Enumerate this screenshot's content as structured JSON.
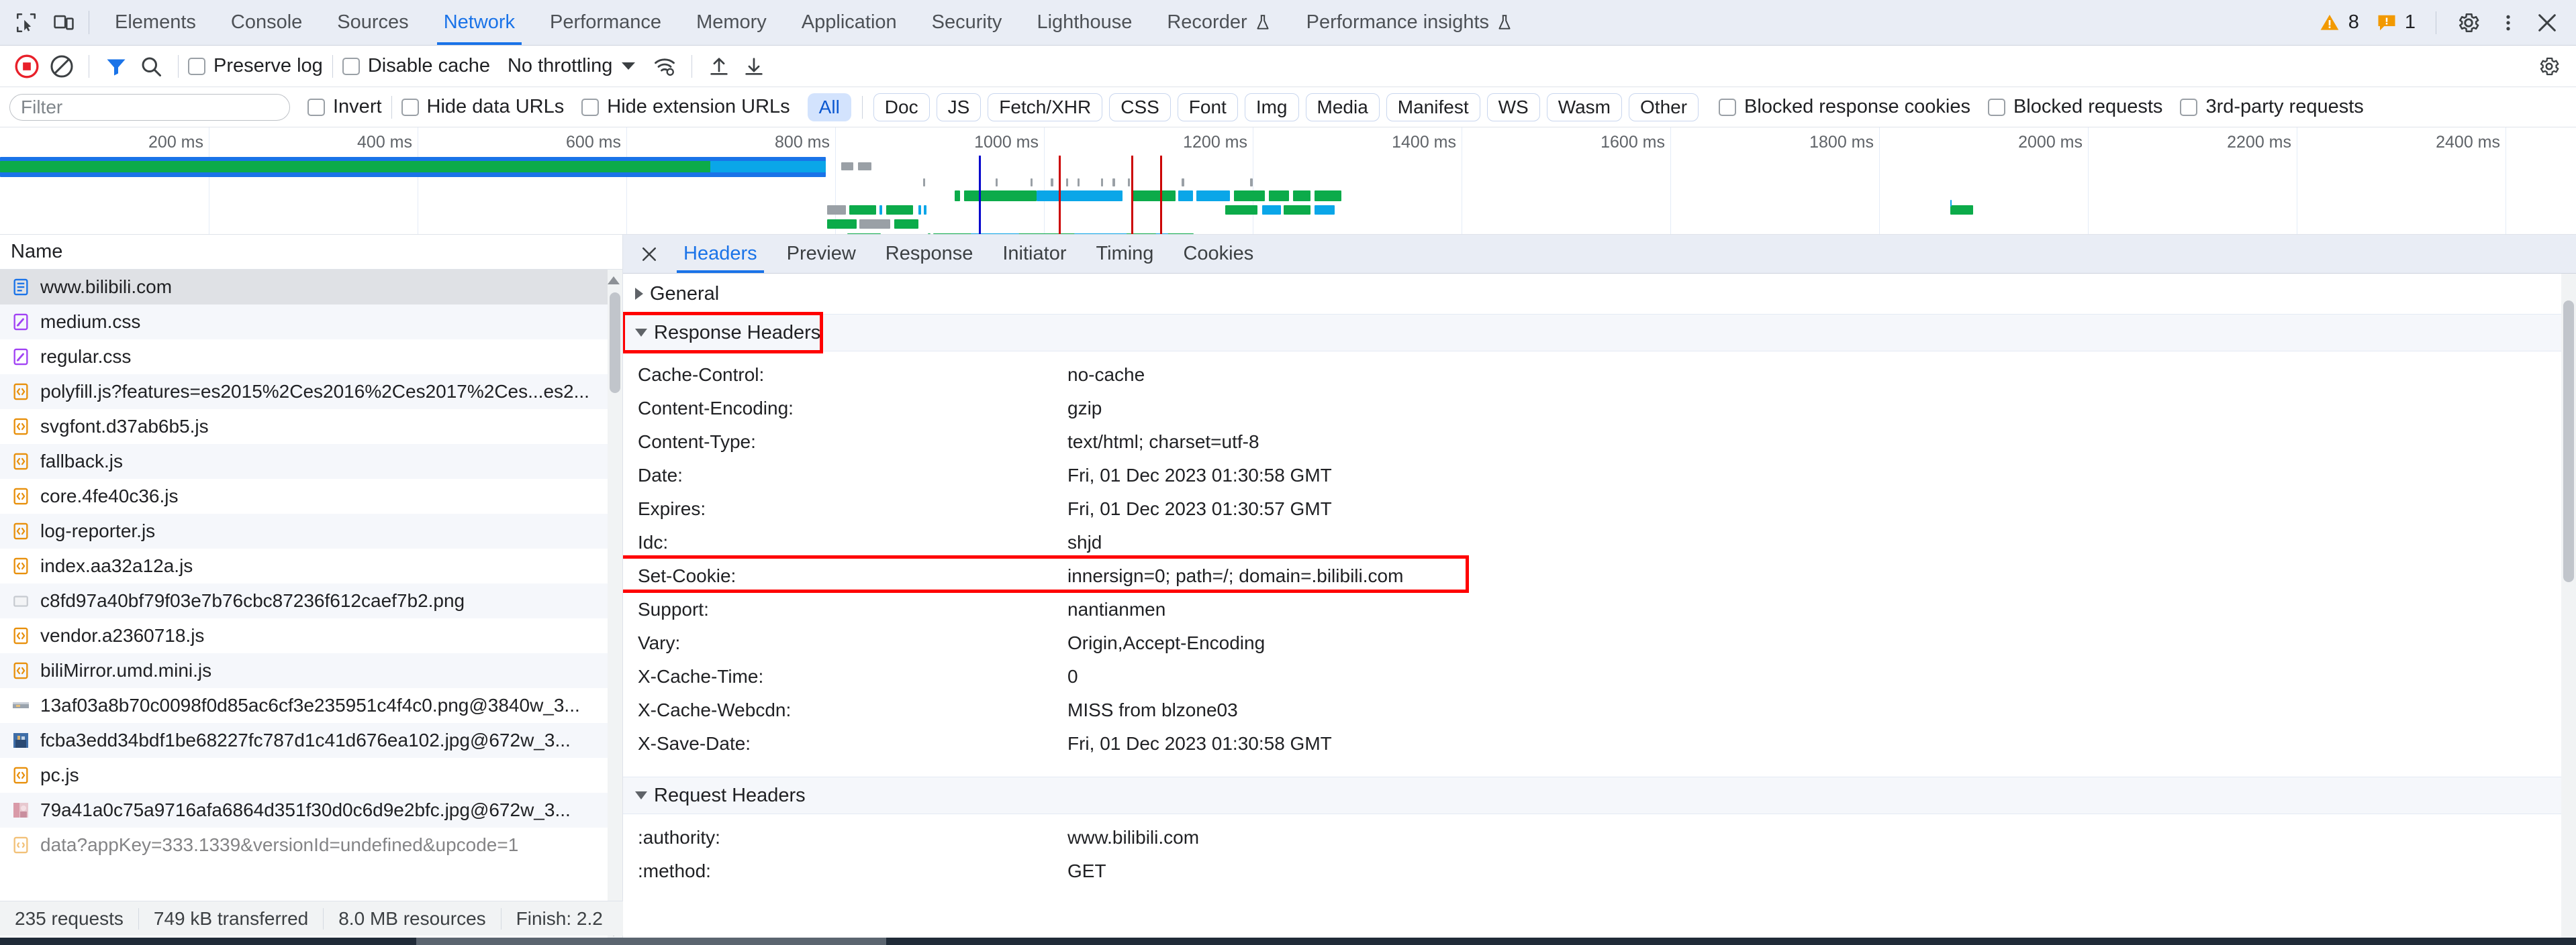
{
  "tabbar": {
    "icons": [
      {
        "name": "inspect-element-icon"
      },
      {
        "name": "device-toolbar-icon"
      }
    ],
    "tabs": [
      {
        "label": "Elements",
        "active": false,
        "flask": false
      },
      {
        "label": "Console",
        "active": false,
        "flask": false
      },
      {
        "label": "Sources",
        "active": false,
        "flask": false
      },
      {
        "label": "Network",
        "active": true,
        "flask": false
      },
      {
        "label": "Performance",
        "active": false,
        "flask": false
      },
      {
        "label": "Memory",
        "active": false,
        "flask": false
      },
      {
        "label": "Application",
        "active": false,
        "flask": false
      },
      {
        "label": "Security",
        "active": false,
        "flask": false
      },
      {
        "label": "Lighthouse",
        "active": false,
        "flask": false
      },
      {
        "label": "Recorder",
        "active": false,
        "flask": true
      },
      {
        "label": "Performance insights",
        "active": false,
        "flask": true
      }
    ],
    "warnings_count": "8",
    "issues_count": "1",
    "active_color": "#1a73e8",
    "warning_color": "#f29900"
  },
  "toolbar": {
    "record_title": "record-button",
    "clear_title": "clear-button",
    "preserve_log_label": "Preserve log",
    "preserve_log_checked": false,
    "disable_cache_label": "Disable cache",
    "disable_cache_checked": false,
    "throttling_value": "No throttling"
  },
  "filterbar": {
    "filter_placeholder": "Filter",
    "filter_value": "",
    "invert_label": "Invert",
    "hide_data_urls_label": "Hide data URLs",
    "hide_extension_urls_label": "Hide extension URLs",
    "types": [
      {
        "label": "All",
        "active": true
      },
      {
        "label": "Doc",
        "active": false
      },
      {
        "label": "JS",
        "active": false
      },
      {
        "label": "Fetch/XHR",
        "active": false
      },
      {
        "label": "CSS",
        "active": false
      },
      {
        "label": "Font",
        "active": false
      },
      {
        "label": "Img",
        "active": false
      },
      {
        "label": "Media",
        "active": false
      },
      {
        "label": "Manifest",
        "active": false
      },
      {
        "label": "WS",
        "active": false
      },
      {
        "label": "Wasm",
        "active": false
      },
      {
        "label": "Other",
        "active": false
      }
    ],
    "blocked_response_cookies_label": "Blocked response cookies",
    "blocked_requests_label": "Blocked requests",
    "third_party_requests_label": "3rd-party requests"
  },
  "overview": {
    "tick_labels": [
      "200 ms",
      "400 ms",
      "600 ms",
      "800 ms",
      "1000 ms",
      "1200 ms",
      "1400 ms",
      "1600 ms",
      "1800 ms",
      "2000 ms",
      "2200 ms",
      "2400 ms"
    ],
    "dcl_event_color": "#0000cc",
    "load_event_color": "#cc0000"
  },
  "requests": {
    "column_header": "Name",
    "items": [
      {
        "name": "www.bilibili.com",
        "type": "doc",
        "selected": true
      },
      {
        "name": "medium.css",
        "type": "css",
        "selected": false
      },
      {
        "name": "regular.css",
        "type": "css",
        "selected": false
      },
      {
        "name": "polyfill.js?features=es2015%2Ces2016%2Ces2017%2Ces...es2...",
        "type": "js",
        "selected": false
      },
      {
        "name": "svgfont.d37ab6b5.js",
        "type": "js",
        "selected": false
      },
      {
        "name": "fallback.js",
        "type": "js",
        "selected": false
      },
      {
        "name": "core.4fe40c36.js",
        "type": "js",
        "selected": false
      },
      {
        "name": "log-reporter.js",
        "type": "js",
        "selected": false
      },
      {
        "name": "index.aa32a12a.js",
        "type": "js",
        "selected": false
      },
      {
        "name": "c8fd97a40bf79f03e7b76cbc87236f612caef7b2.png",
        "type": "img-blank",
        "selected": false
      },
      {
        "name": "vendor.a2360718.js",
        "type": "js",
        "selected": false
      },
      {
        "name": "biliMirror.umd.mini.js",
        "type": "js",
        "selected": false
      },
      {
        "name": "13af03a8b70c0098f0d85ac6cf3e235951c4f4c0.png@3840w_3...",
        "type": "img-thumb",
        "selected": false
      },
      {
        "name": "fcba3edd34bdf1be68227fc787d1c41d676ea102.jpg@672w_3...",
        "type": "img-thumb",
        "selected": false
      },
      {
        "name": "pc.js",
        "type": "js",
        "selected": false
      },
      {
        "name": "79a41a0c75a9716afa6864d351f30d0c6d9e2bfc.jpg@672w_3...",
        "type": "img-thumb",
        "selected": false
      },
      {
        "name": "data?appKey=333.1339&versionId=undefined&upcode=1",
        "type": "fetch",
        "selected": false
      }
    ]
  },
  "status": {
    "requests": "235 requests",
    "transferred": "749 kB transferred",
    "resources": "8.0 MB resources",
    "finish": "Finish: 2.2"
  },
  "detail": {
    "tabs": [
      {
        "label": "Headers",
        "active": true
      },
      {
        "label": "Preview",
        "active": false
      },
      {
        "label": "Response",
        "active": false
      },
      {
        "label": "Initiator",
        "active": false
      },
      {
        "label": "Timing",
        "active": false
      },
      {
        "label": "Cookies",
        "active": false
      }
    ],
    "general_label": "General",
    "general_expanded": false,
    "response_headers_label": "Response Headers",
    "response_headers_expanded": true,
    "response_headers": [
      {
        "key": "Cache-Control:",
        "value": "no-cache",
        "highlighted": false
      },
      {
        "key": "Content-Encoding:",
        "value": "gzip",
        "highlighted": false
      },
      {
        "key": "Content-Type:",
        "value": "text/html; charset=utf-8",
        "highlighted": false
      },
      {
        "key": "Date:",
        "value": "Fri, 01 Dec 2023 01:30:58 GMT",
        "highlighted": false
      },
      {
        "key": "Expires:",
        "value": "Fri, 01 Dec 2023 01:30:57 GMT",
        "highlighted": false
      },
      {
        "key": "Idc:",
        "value": "shjd",
        "highlighted": false
      },
      {
        "key": "Set-Cookie:",
        "value": "innersign=0; path=/; domain=.bilibili.com",
        "highlighted": true
      },
      {
        "key": "Support:",
        "value": "nantianmen",
        "highlighted": false
      },
      {
        "key": "Vary:",
        "value": "Origin,Accept-Encoding",
        "highlighted": false
      },
      {
        "key": "X-Cache-Time:",
        "value": "0",
        "highlighted": false
      },
      {
        "key": "X-Cache-Webcdn:",
        "value": "MISS from blzone03",
        "highlighted": false
      },
      {
        "key": "X-Save-Date:",
        "value": "Fri, 01 Dec 2023 01:30:58 GMT",
        "highlighted": false
      }
    ],
    "request_headers_label": "Request Headers",
    "request_headers_expanded": true,
    "request_headers": [
      {
        "key": ":authority:",
        "value": "www.bilibili.com",
        "highlighted": false
      },
      {
        "key": ":method:",
        "value": "GET",
        "highlighted": false
      }
    ],
    "annotation_color": "#ff0000"
  }
}
